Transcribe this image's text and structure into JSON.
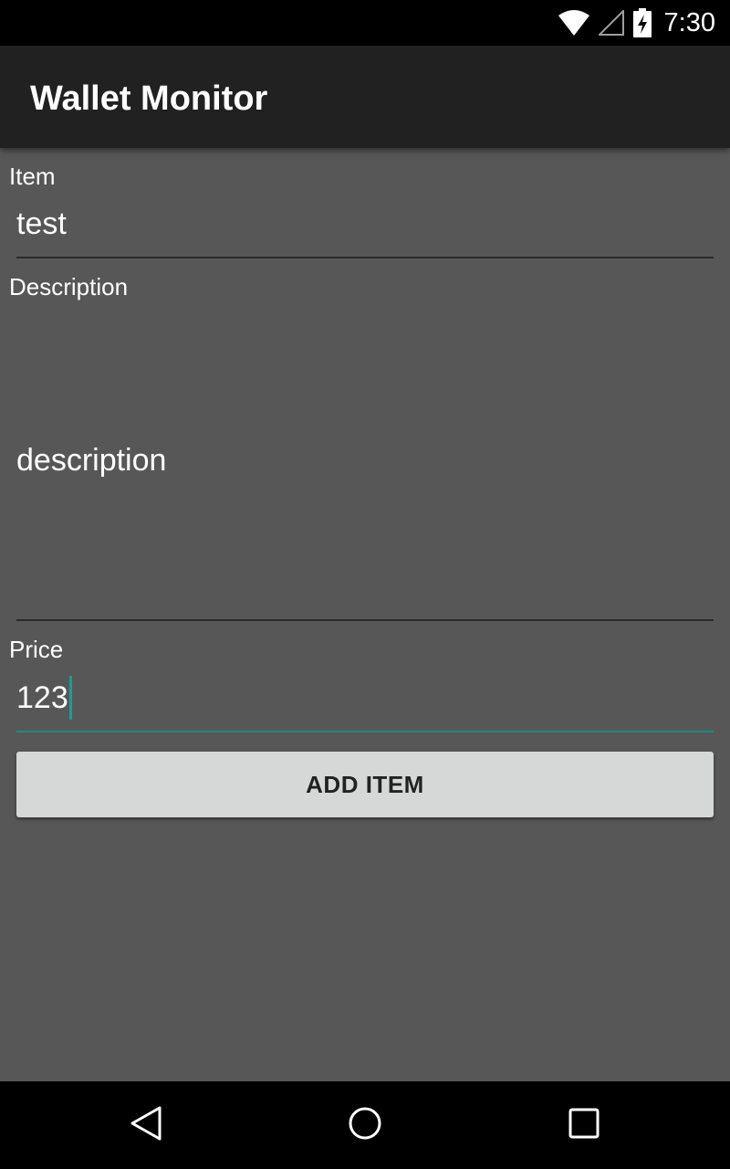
{
  "status_bar": {
    "time": "7:30",
    "icons": [
      "wifi-icon",
      "cell-signal-icon",
      "battery-charging-icon"
    ]
  },
  "app_bar": {
    "title": "Wallet Monitor"
  },
  "form": {
    "item": {
      "label": "Item",
      "value": "test"
    },
    "description": {
      "label": "Description",
      "value": "description"
    },
    "price": {
      "label": "Price",
      "value": "123"
    },
    "add_button_label": "ADD ITEM"
  },
  "nav_bar": {
    "icons": [
      "back-icon",
      "home-icon",
      "recents-icon"
    ]
  },
  "colors": {
    "background": "#575757",
    "app_bar": "#212121",
    "accent": "#1f9d90",
    "button": "#d6d7d7"
  }
}
